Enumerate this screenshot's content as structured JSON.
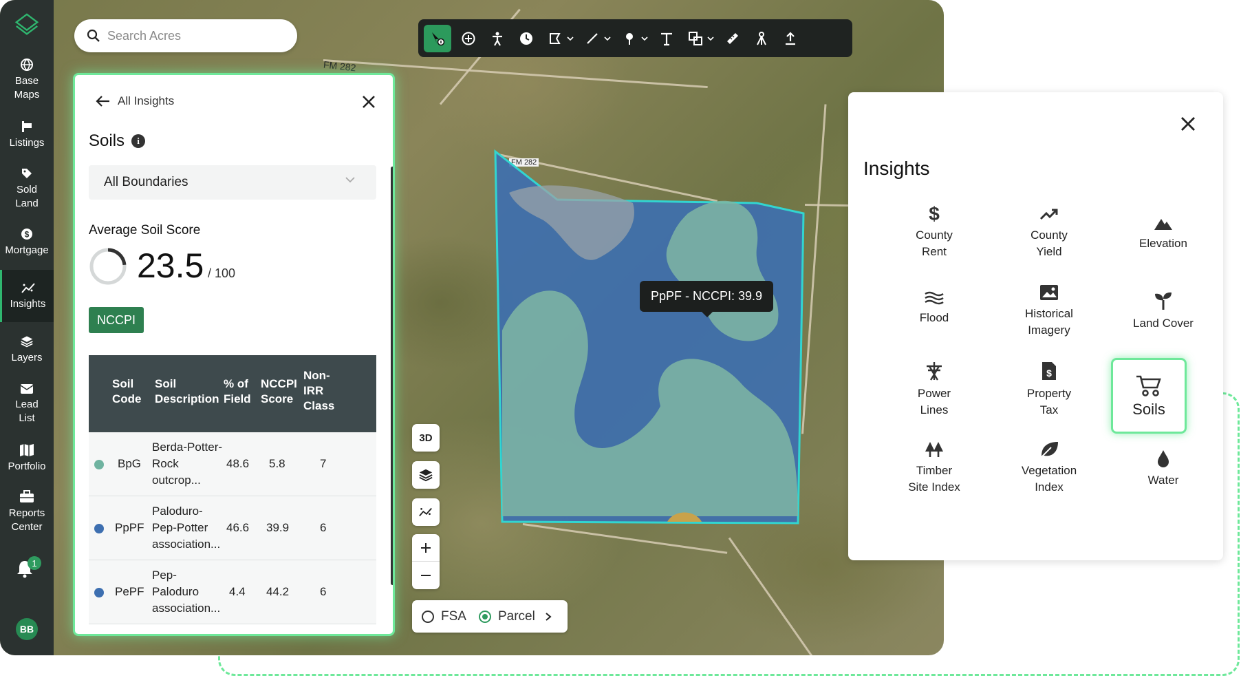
{
  "search": {
    "placeholder": "Search Acres"
  },
  "nav": {
    "items": [
      {
        "label_1": "Base",
        "label_2": "Maps"
      },
      {
        "label_1": "Listings",
        "label_2": ""
      },
      {
        "label_1": "Sold",
        "label_2": "Land"
      },
      {
        "label_1": "Mortgage",
        "label_2": ""
      },
      {
        "label_1": "Insights",
        "label_2": ""
      },
      {
        "label_1": "Layers",
        "label_2": ""
      },
      {
        "label_1": "Lead",
        "label_2": "List"
      },
      {
        "label_1": "Portfolio",
        "label_2": ""
      },
      {
        "label_1": "Reports",
        "label_2": "Center"
      }
    ],
    "notifications": "1",
    "avatar": "BB"
  },
  "map": {
    "road_label_1": "FM 282",
    "road_label_2": "FM 282",
    "tooltip": "PpPF - NCCPI: 39.9",
    "btn_3d": "3D",
    "layer_fsa": "FSA",
    "layer_parcel": "Parcel",
    "selected_layer": "Parcel"
  },
  "soils": {
    "back_label": "All Insights",
    "title": "Soils",
    "boundary_select": "All Boundaries",
    "avg_label": "Average Soil Score",
    "avg_score": "23.5",
    "avg_max": "/ 100",
    "avg_fraction": 0.235,
    "chip": "NCCPI",
    "headers": {
      "code_1": "Soil",
      "code_2": "Code",
      "desc_1": "Soil",
      "desc_2": "Description",
      "pct_1": "% of",
      "pct_2": "Field",
      "nccpi_1": "NCCPI",
      "nccpi_2": "Score",
      "irr_1": "Non-",
      "irr_2": "IRR",
      "irr_3": "Class"
    },
    "rows": [
      {
        "color": "#6fb3a0",
        "code": "BpG",
        "desc_1": "Berda-Potter-",
        "desc_2": "Rock",
        "desc_3": "outcrop...",
        "pct": "48.6",
        "nccpi": "5.8",
        "irr": "7"
      },
      {
        "color": "#3d6fb0",
        "code": "PpPF",
        "desc_1": "Paloduro-",
        "desc_2": "Pep-Potter",
        "desc_3": "association...",
        "pct": "46.6",
        "nccpi": "39.9",
        "irr": "6"
      },
      {
        "color": "#3d6fb0",
        "code": "PePF",
        "desc_1": "Pep-",
        "desc_2": "Paloduro",
        "desc_3": "association...",
        "pct": "4.4",
        "nccpi": "44.2",
        "irr": "6"
      }
    ]
  },
  "insights": {
    "title": "Insights",
    "items": [
      {
        "icon": "dollar-icon",
        "label_1": "County",
        "label_2": "Rent"
      },
      {
        "icon": "trend-up-icon",
        "label_1": "County",
        "label_2": "Yield"
      },
      {
        "icon": "mountain-icon",
        "label_1": "Elevation",
        "label_2": ""
      },
      {
        "icon": "waves-icon",
        "label_1": "Flood",
        "label_2": ""
      },
      {
        "icon": "image-icon",
        "label_1": "Historical",
        "label_2": "Imagery"
      },
      {
        "icon": "sprout-icon",
        "label_1": "Land Cover",
        "label_2": ""
      },
      {
        "icon": "power-tower-icon",
        "label_1": "Power",
        "label_2": "Lines"
      },
      {
        "icon": "tax-document-icon",
        "label_1": "Property",
        "label_2": "Tax"
      },
      {
        "icon": "wheelbarrow-icon",
        "label_1": "Soils",
        "label_2": ""
      },
      {
        "icon": "trees-icon",
        "label_1": "Timber",
        "label_2": "Site Index"
      },
      {
        "icon": "leaf-icon",
        "label_1": "Vegetation",
        "label_2": "Index"
      },
      {
        "icon": "water-drop-icon",
        "label_1": "Water",
        "label_2": ""
      }
    ]
  },
  "colors": {
    "accent": "#2f9b5f",
    "highlight": "#6ee89a",
    "soil_blue": "#3d6fb0",
    "soil_teal": "#6fb3a0"
  }
}
